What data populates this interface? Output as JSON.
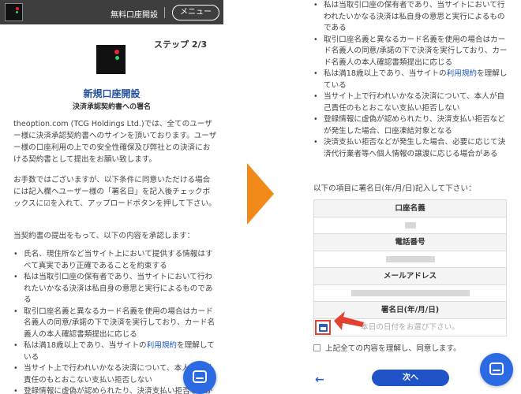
{
  "colors": {
    "header_bg": "#3e3e3e",
    "title_blue": "#1f4f9d",
    "link_blue": "#1e5bbf",
    "chat_blue": "#2b6ae3",
    "next_button_blue": "#2052c8",
    "arrow_orange": "#f28a1a",
    "highlight_red": "#e0422f"
  },
  "header": {
    "open_account_label": "無料口座開設",
    "menu_label": "メニュー"
  },
  "left": {
    "step": "ステップ 2/3",
    "title": "新規口座開設",
    "subtitle": "決済承認契約書への署名",
    "para1": "theoption.com (TCG Holdings Ltd.)では、全てのユーザー様に決済承認契約書へのサインを頂いております。ユーザー様の口座利用の上での安全性確保及び弊社との決済における契約書として提出をお願い致します。",
    "para2": "お手数ではございますが、以下条件に同意いただける場合には記入欄へユーザー様の「署名日」を記入後チェックボックスに☑を入れて、アップロードボタンを押して下さい。",
    "para3": "当契約書の提出をもって、以下の内容を承認します：",
    "list": [
      "氏名、現住所など当サイト上において提供する情報はすべて真実であり正確であることを約束する",
      "私は当取引口座の保有者であり、当サイトにおいて行われたいかなる決済は私自身の意思と実行によるものである",
      "取引口座名義と異なるカード名義を使用の場合はカード名義人の同意/承諾の下で決済を実行しており、カード名義人の本人確認書類提出に応じる",
      "私は満18歳以上であり、当サイトの利用規約を理解している",
      "当サイト上で行われいかなる決済について、本人が自己責任のもとおこない支払い拒否しない",
      "登録情報に虚偽が認められたり、決済支払い拒否などが発生した場合、口座凍結対象となる"
    ]
  },
  "right": {
    "list": [
      "私は当取引口座の保有者であり、当サイトにおいて行われたいかなる決済は私自身の意思と実行によるものである",
      "取引口座名義と異なるカード名義を使用の場合はカード名義人の同意/承諾の下で決済を実行しており、カード名義人の本人確認書類提出に応じる",
      "私は満18歳以上であり、当サイトの利用規約を理解している",
      "当サイト上で行われいかなる決済について、本人が自己責任のもとおこない支払い拒否しない",
      "登録情報に虚偽が認められたり、決済支払い拒否などが発生した場合、口座凍結対象となる",
      "決済支払い拒否などが発生した場合、必要に応じて決済代行業者等へ個人情報の譲渡に応じる場合がある"
    ],
    "date_instruction": "以下の項目に署名日(年/月/日)記入して下さい：",
    "table": {
      "account_name_label": "口座名義",
      "phone_label": "電話番号",
      "email_label": "メールアドレス",
      "sign_date_label": "署名日(年/月/日)",
      "date_placeholder": "本日の日付をお選び下さい。"
    },
    "agree_label": "上記全ての内容を理解し、同意します。",
    "back_label": "←",
    "next_label": "次へ"
  },
  "link_text": "利用規約"
}
